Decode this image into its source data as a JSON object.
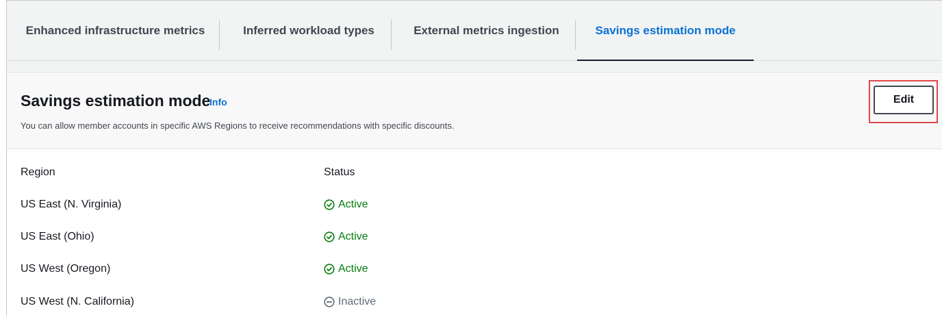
{
  "tabs": [
    {
      "label": "Enhanced infrastructure metrics",
      "active": false
    },
    {
      "label": "Inferred workload types",
      "active": false
    },
    {
      "label": "External metrics ingestion",
      "active": false
    },
    {
      "label": "Savings estimation mode",
      "active": true
    }
  ],
  "panel": {
    "title": "Savings estimation mode",
    "info_label": "Info",
    "description": "You can allow member accounts in specific AWS Regions to receive recommendations with specific discounts.",
    "edit_label": "Edit"
  },
  "table": {
    "columns": [
      "Region",
      "Status"
    ],
    "rows": [
      {
        "region": "US East (N. Virginia)",
        "status": "Active",
        "status_icon": "check-circle-icon"
      },
      {
        "region": "US East (Ohio)",
        "status": "Active",
        "status_icon": "check-circle-icon"
      },
      {
        "region": "US West (Oregon)",
        "status": "Active",
        "status_icon": "check-circle-icon"
      },
      {
        "region": "US West (N. California)",
        "status": "Inactive",
        "status_icon": "minus-circle-icon"
      }
    ]
  },
  "colors": {
    "accent": "#0972d3",
    "active": "#037f0c",
    "inactive": "#5f6b7a",
    "highlight": "#e0474c"
  }
}
